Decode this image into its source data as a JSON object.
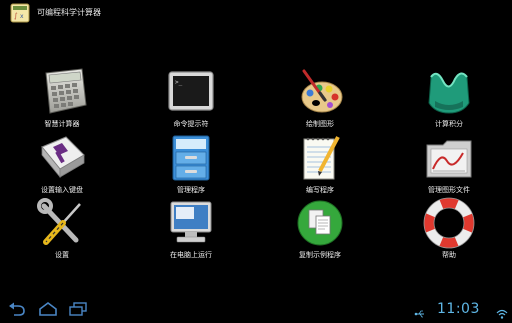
{
  "window": {
    "app_title": "可编程科学计算器"
  },
  "launcher": {
    "items": [
      {
        "label": "智慧计算器",
        "icon": "calculator-icon"
      },
      {
        "label": "命令提示符",
        "icon": "terminal-icon"
      },
      {
        "label": "绘制图形",
        "icon": "paint-palette-icon"
      },
      {
        "label": "计算积分",
        "icon": "integral-shape-icon"
      },
      {
        "label": "设置输入键盘",
        "icon": "keyboard-key-icon"
      },
      {
        "label": "管理程序",
        "icon": "file-cabinet-icon"
      },
      {
        "label": "编写程序",
        "icon": "notepad-pencil-icon"
      },
      {
        "label": "管理图形文件",
        "icon": "graph-folder-icon"
      },
      {
        "label": "设置",
        "icon": "wrench-screwdriver-icon"
      },
      {
        "label": "在电脑上运行",
        "icon": "computer-icon"
      },
      {
        "label": "复制示例程序",
        "icon": "copy-documents-icon"
      },
      {
        "label": "帮助",
        "icon": "lifebuoy-icon"
      }
    ]
  },
  "system_bar": {
    "clock": "11:03",
    "nav_icons": [
      "back-icon",
      "home-icon",
      "recent-apps-icon"
    ],
    "status_icons": [
      "usb-icon",
      "wifi-icon"
    ],
    "accent": "#5fb7e6"
  }
}
